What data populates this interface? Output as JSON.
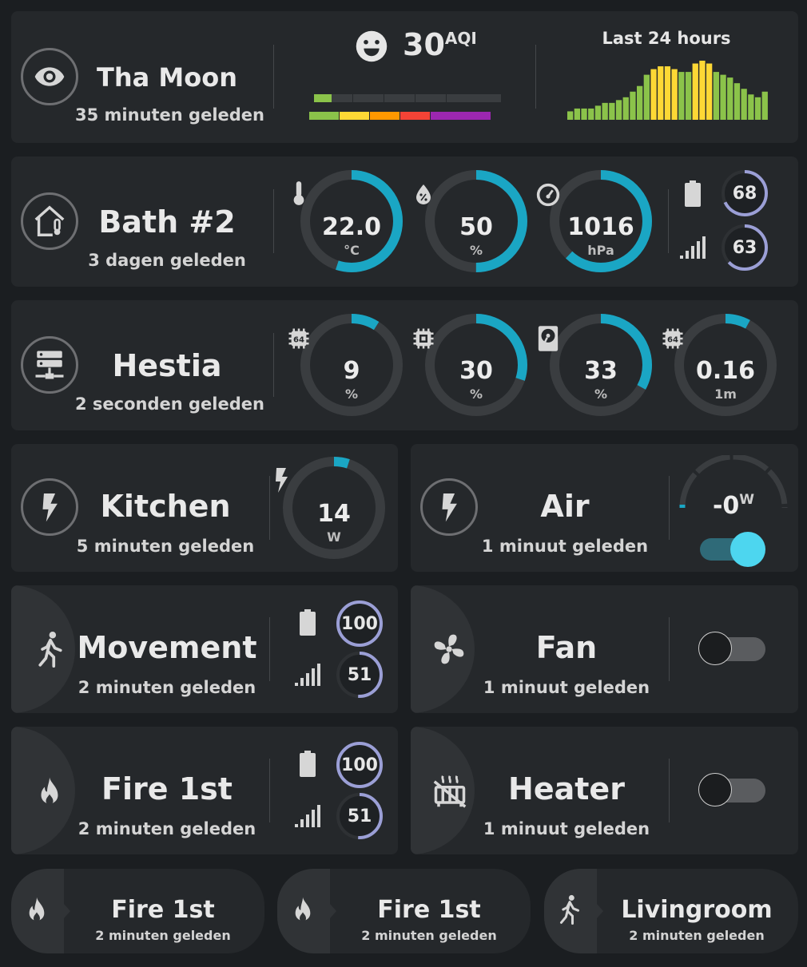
{
  "moon": {
    "name": "Tha Moon",
    "subtitle": "35 minuten geleden",
    "aqi_value": "30",
    "aqi_unit": "AQI",
    "history_title": "Last 24 hours",
    "history": [
      3,
      4,
      4,
      4,
      5,
      6,
      6,
      7,
      8,
      10,
      12,
      16,
      18,
      19,
      19,
      18,
      17,
      17,
      20,
      21,
      20,
      17,
      16,
      15,
      13,
      11,
      9,
      8,
      10
    ],
    "history_colors": [
      "#8bc34a",
      "#8bc34a",
      "#8bc34a",
      "#8bc34a",
      "#8bc34a",
      "#8bc34a",
      "#8bc34a",
      "#8bc34a",
      "#8bc34a",
      "#8bc34a",
      "#8bc34a",
      "#8bc34a",
      "#fdd835",
      "#fdd835",
      "#fdd835",
      "#fdd835",
      "#8bc34a",
      "#8bc34a",
      "#fdd835",
      "#fdd835",
      "#fdd835",
      "#8bc34a",
      "#8bc34a",
      "#8bc34a",
      "#8bc34a",
      "#8bc34a",
      "#8bc34a",
      "#8bc34a",
      "#8bc34a"
    ],
    "scale_colors": [
      "#8bc34a",
      "#fdd835",
      "#ff9800",
      "#f44336",
      "#9c27b0"
    ]
  },
  "bath": {
    "name": "Bath #2",
    "subtitle": "3 dagen geleden",
    "temperature": {
      "value": "22.0",
      "unit": "°C",
      "fraction": 0.55
    },
    "humidity": {
      "value": "50",
      "unit": "%",
      "fraction": 0.5
    },
    "pressure": {
      "value": "1016",
      "unit": "hPa",
      "fraction": 0.62
    },
    "battery": "68",
    "battery_fraction": 0.68,
    "signal": "63",
    "signal_fraction": 0.63
  },
  "hestia": {
    "name": "Hestia",
    "subtitle": "2 seconden geleden",
    "gauges": [
      {
        "value": "9",
        "unit": "%",
        "fraction": 0.09
      },
      {
        "value": "30",
        "unit": "%",
        "fraction": 0.3
      },
      {
        "value": "33",
        "unit": "%",
        "fraction": 0.33
      },
      {
        "value": "0.16",
        "unit": "1m",
        "fraction": 0.08
      }
    ]
  },
  "kitchen": {
    "name": "Kitchen",
    "subtitle": "5 minuten geleden",
    "value": "14",
    "unit": "W",
    "fraction": 0.05
  },
  "air": {
    "name": "Air",
    "subtitle": "1 minuut geleden",
    "value": "-0",
    "unit": "W",
    "toggle_on": true
  },
  "movement": {
    "name": "Movement",
    "subtitle": "2 minuten geleden",
    "battery": "100",
    "battery_fraction": 1.0,
    "signal": "51",
    "signal_fraction": 0.51
  },
  "fan": {
    "name": "Fan",
    "subtitle": "1 minuut geleden",
    "toggle_on": false
  },
  "fire": {
    "name": "Fire 1st",
    "subtitle": "2 minuten geleden",
    "battery": "100",
    "battery_fraction": 1.0,
    "signal": "51",
    "signal_fraction": 0.51
  },
  "heater": {
    "name": "Heater",
    "subtitle": "1 minuut geleden",
    "toggle_on": false
  },
  "pills": [
    {
      "name": "Fire 1st",
      "subtitle": "2 minuten geleden"
    },
    {
      "name": "Fire 1st",
      "subtitle": "2 minuten geleden"
    },
    {
      "name": "Livingroom",
      "subtitle": "2 minuten geleden"
    }
  ],
  "colors": {
    "accent": "#1aa6c4",
    "track": "#3a3d40",
    "ring_lavender": "#9b9fd6",
    "toggle_on": "#4dd6ef"
  }
}
